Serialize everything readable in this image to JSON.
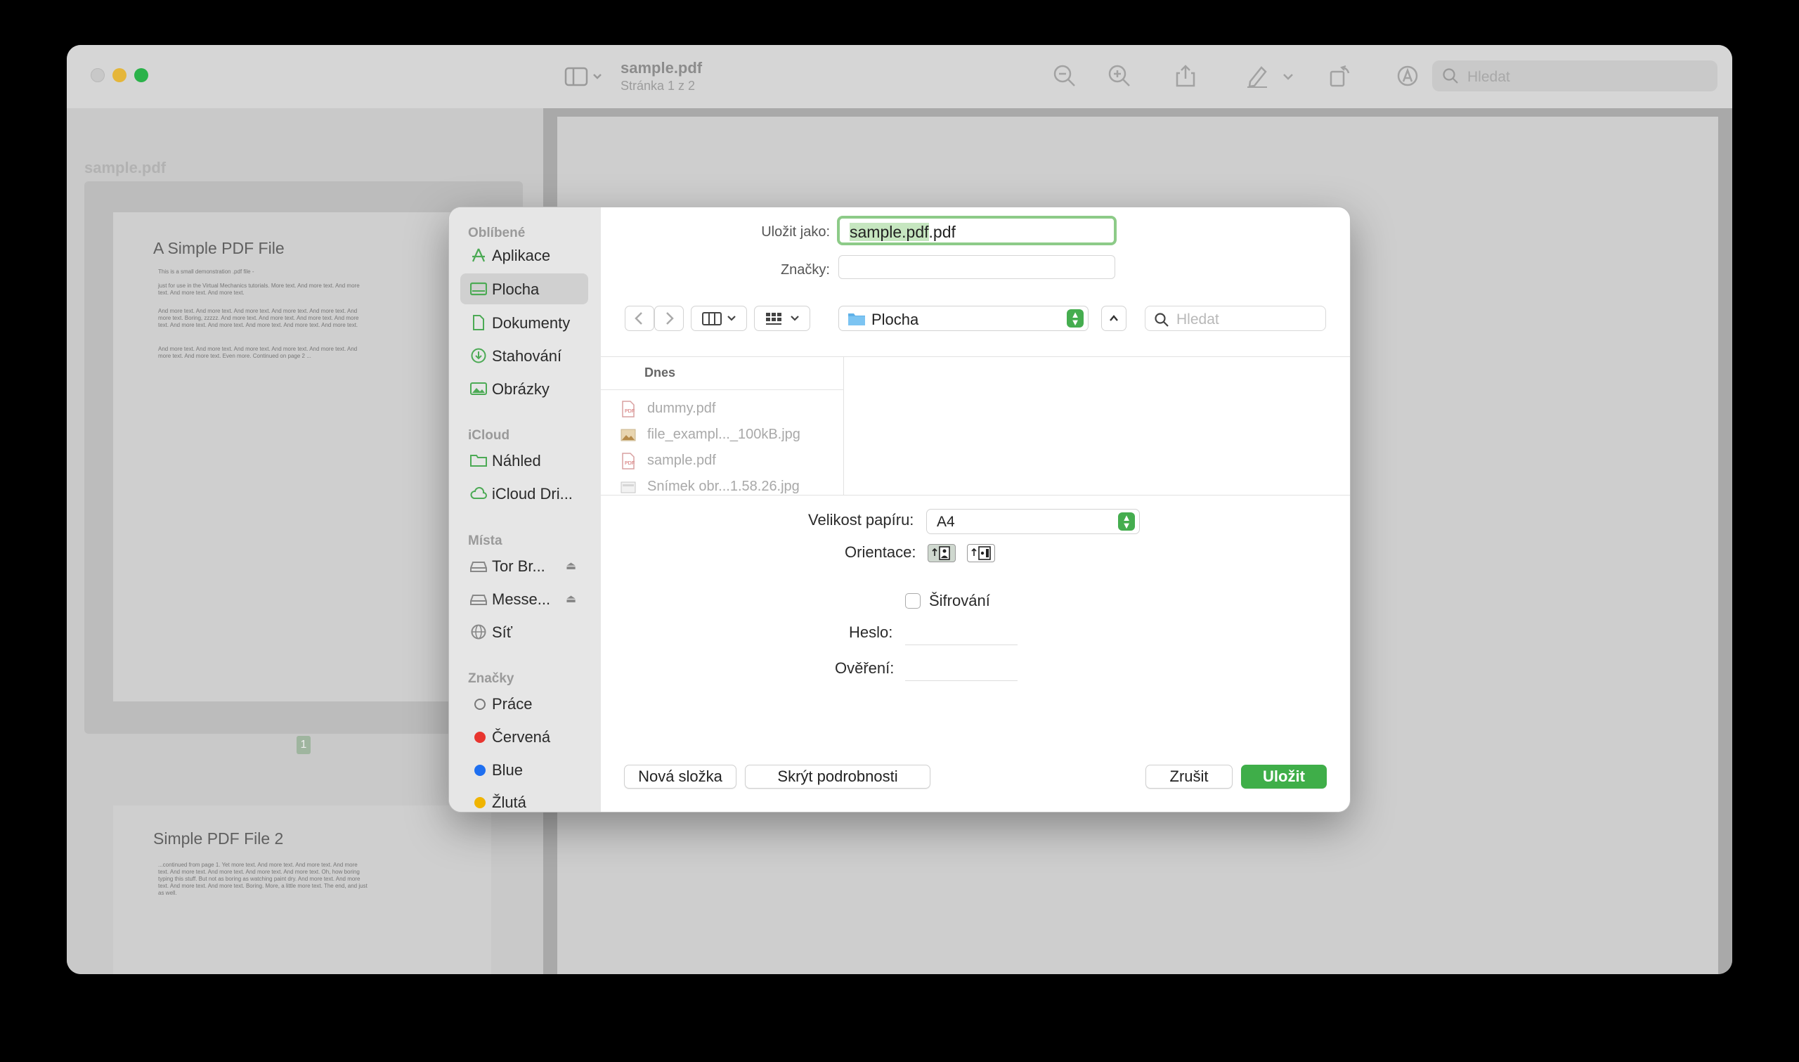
{
  "window": {
    "doc_title": "sample.pdf",
    "doc_subtitle": "Stránka 1 z 2",
    "search_placeholder": "Hledat"
  },
  "thumbnails": {
    "label": "sample.pdf",
    "page_number": "1",
    "page1_title": "A Simple PDF File",
    "page1_lines": [
      "This is a small demonstration .pdf file -",
      "just for use in the Virtual Mechanics tutorials. More text. And more text. And more text. And more text. And more text.",
      "And more text. And more text. And more text. And more text. And more text. And more text. Boring, zzzzz. And more text. And more text. And more text. And more text. And more text. And more text. And more text. And more text. And more text.",
      "And more text. And more text. And more text. And more text. And more text. And more text. And more text. Even more. Continued on page 2 ..."
    ],
    "page2_title": "Simple PDF File 2",
    "page2_lines": [
      "...continued from page 1. Yet more text. And more text. And more text. And more text. And more text. And more text. And more text. And more text. Oh, how boring typing this stuff. But not as boring as watching paint dry. And more text. And more text. And more text. And more text. Boring. More, a little more text. The end, and just as well."
    ]
  },
  "dialog": {
    "sidebar": {
      "favorites_title": "Oblíbené",
      "favorites": [
        {
          "label": "Aplikace",
          "icon": "apps-icon"
        },
        {
          "label": "Plocha",
          "icon": "desktop-icon",
          "selected": true
        },
        {
          "label": "Dokumenty",
          "icon": "document-icon"
        },
        {
          "label": "Stahování",
          "icon": "download-icon"
        },
        {
          "label": "Obrázky",
          "icon": "photos-icon"
        }
      ],
      "icloud_title": "iCloud",
      "icloud": [
        {
          "label": "Náhled",
          "icon": "folder-icon"
        },
        {
          "label": "iCloud Dri...",
          "icon": "cloud-icon"
        }
      ],
      "places_title": "Místa",
      "places": [
        {
          "label": "Tor Br...",
          "icon": "drive-icon",
          "eject": "⏏"
        },
        {
          "label": "Messe...",
          "icon": "drive-icon",
          "eject": "⏏"
        },
        {
          "label": "Síť",
          "icon": "network-icon"
        }
      ],
      "tags_title": "Značky",
      "tags": [
        {
          "label": "Práce",
          "color": "#ffffff"
        },
        {
          "label": "Červená",
          "color": "#e8352f"
        },
        {
          "label": "Blue",
          "color": "#1e6ff0"
        },
        {
          "label": "Žlutá",
          "color": "#f0b400"
        }
      ]
    },
    "save_as_label": "Uložit jako:",
    "save_as_selected": "sample.pdf",
    "save_as_rest": ".pdf",
    "tags_label": "Značky:",
    "location": "Plocha",
    "search_placeholder": "Hledat",
    "browser": {
      "column_header": "Dnes",
      "files": [
        {
          "name": "dummy.pdf",
          "type": "pdf"
        },
        {
          "name": "file_exampl..._100kB.jpg",
          "type": "image"
        },
        {
          "name": "sample.pdf",
          "type": "pdf"
        },
        {
          "name": "Snímek obr...1.58.26.jpg",
          "type": "screenshot"
        }
      ]
    },
    "paper_size_label": "Velikost papíru:",
    "paper_size_value": "A4",
    "orientation_label": "Orientace:",
    "encryption_label": "Šifrování",
    "password_label": "Heslo:",
    "verify_label": "Ověření:",
    "buttons": {
      "new_folder": "Nová složka",
      "hide_details": "Skrýt podrobnosti",
      "cancel": "Zrušit",
      "save": "Uložit"
    },
    "accent_color": "#3fae49"
  }
}
